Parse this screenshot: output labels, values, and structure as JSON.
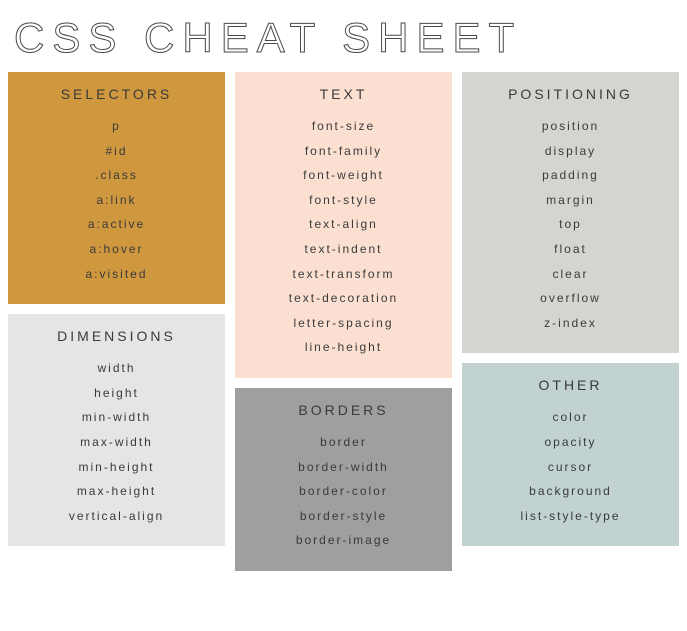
{
  "title": "CSS CHEAT SHEET",
  "columns": [
    [
      {
        "title": "SELECTORS",
        "bg": "c-mustard",
        "items": [
          "p",
          "#id",
          ".class",
          "a:link",
          "a:active",
          "a:hover",
          "a:visited"
        ]
      },
      {
        "title": "DIMENSIONS",
        "bg": "c-grey-light",
        "items": [
          "width",
          "height",
          "min-width",
          "max-width",
          "min-height",
          "max-height",
          "vertical-align"
        ]
      }
    ],
    [
      {
        "title": "TEXT",
        "bg": "c-peach",
        "items": [
          "font-size",
          "font-family",
          "font-weight",
          "font-style",
          "text-align",
          "text-indent",
          "text-transform",
          "text-decoration",
          "letter-spacing",
          "line-height"
        ]
      },
      {
        "title": "BORDERS",
        "bg": "c-grey-mid",
        "items": [
          "border",
          "border-width",
          "border-color",
          "border-style",
          "border-image"
        ]
      }
    ],
    [
      {
        "title": "POSITIONING",
        "bg": "c-greyblue",
        "items": [
          "position",
          "display",
          "padding",
          "margin",
          "top",
          "float",
          "clear",
          "overflow",
          "z-index"
        ]
      },
      {
        "title": "OTHER",
        "bg": "c-sage",
        "items": [
          "color",
          "opacity",
          "cursor",
          "background",
          "list-style-type"
        ]
      }
    ]
  ]
}
